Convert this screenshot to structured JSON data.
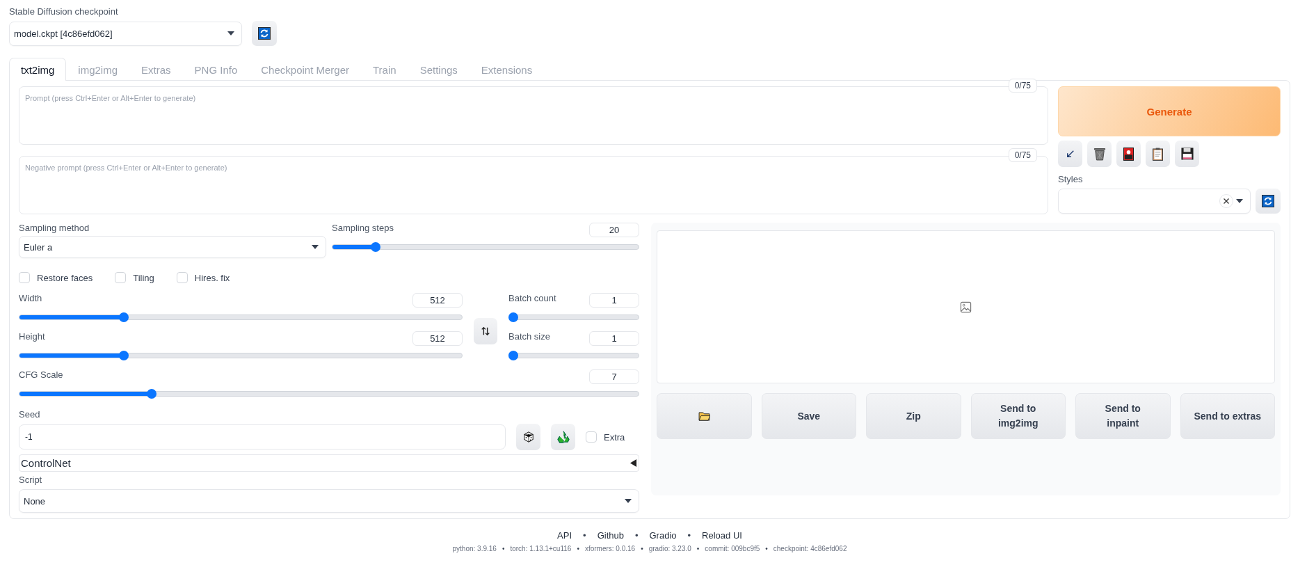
{
  "checkpoint": {
    "label": "Stable Diffusion checkpoint",
    "value": "model.ckpt [4c86efd062]"
  },
  "tabs": [
    {
      "label": "txt2img",
      "selected": true
    },
    {
      "label": "img2img",
      "selected": false
    },
    {
      "label": "Extras",
      "selected": false
    },
    {
      "label": "PNG Info",
      "selected": false
    },
    {
      "label": "Checkpoint Merger",
      "selected": false
    },
    {
      "label": "Train",
      "selected": false
    },
    {
      "label": "Settings",
      "selected": false
    },
    {
      "label": "Extensions",
      "selected": false
    }
  ],
  "prompt": {
    "placeholder": "Prompt (press Ctrl+Enter or Alt+Enter to generate)",
    "counter": "0/75"
  },
  "negative_prompt": {
    "placeholder": "Negative prompt (press Ctrl+Enter or Alt+Enter to generate)",
    "counter": "0/75"
  },
  "generate_button": "Generate",
  "styles": {
    "label": "Styles"
  },
  "sampling_method": {
    "label": "Sampling method",
    "value": "Euler a"
  },
  "sampling_steps": {
    "label": "Sampling steps",
    "value": "20",
    "level": 0.13
  },
  "options": [
    {
      "label": "Restore faces",
      "checked": false
    },
    {
      "label": "Tiling",
      "checked": false
    },
    {
      "label": "Hires. fix",
      "checked": false
    }
  ],
  "width": {
    "label": "Width",
    "value": "512",
    "level": 0.23
  },
  "height": {
    "label": "Height",
    "value": "512",
    "level": 0.23
  },
  "batch_count": {
    "label": "Batch count",
    "value": "1",
    "level": 0
  },
  "batch_size": {
    "label": "Batch size",
    "value": "1",
    "level": 0
  },
  "cfg_scale": {
    "label": "CFG Scale",
    "value": "7",
    "level": 0.21
  },
  "seed": {
    "label": "Seed",
    "value": "-1",
    "extra": {
      "label": "Extra",
      "checked": false
    }
  },
  "controlnet": {
    "label": "ControlNet",
    "expanded": false
  },
  "script": {
    "label": "Script",
    "value": "None"
  },
  "gallery_buttons": [
    {
      "kind": "folder"
    },
    {
      "kind": "text",
      "label": "Save"
    },
    {
      "kind": "text",
      "label": "Zip"
    },
    {
      "kind": "text",
      "label": "Send to img2img"
    },
    {
      "kind": "text",
      "label": "Send to inpaint"
    },
    {
      "kind": "text",
      "label": "Send to extras"
    }
  ],
  "footer": {
    "separator": "•",
    "links": [
      "API",
      "Github",
      "Gradio",
      "Reload UI"
    ],
    "versions": [
      "python: 3.9.16",
      "torch: 1.13.1+cu116",
      "xformers: 0.0.16",
      "gradio: 3.23.0",
      "commit: 009bc9f5",
      "checkpoint: 4c86efd062"
    ]
  }
}
